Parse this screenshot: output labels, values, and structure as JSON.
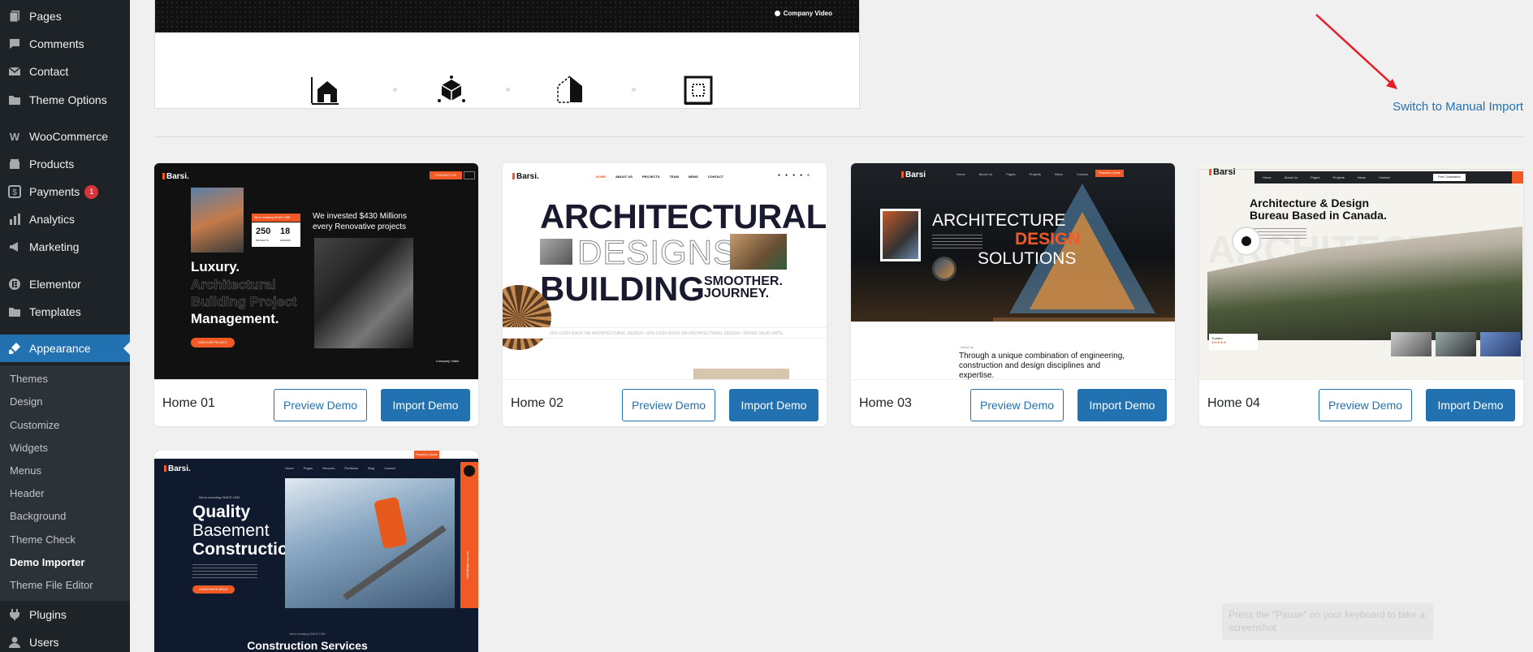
{
  "sidebar": {
    "items": [
      {
        "label": "Pages",
        "icon": "pages-icon"
      },
      {
        "label": "Comments",
        "icon": "comments-icon"
      },
      {
        "label": "Contact",
        "icon": "contact-icon"
      },
      {
        "label": "Theme Options",
        "icon": "folder-icon"
      },
      {
        "label": "WooCommerce",
        "icon": "woocommerce-icon"
      },
      {
        "label": "Products",
        "icon": "products-icon"
      },
      {
        "label": "Payments",
        "icon": "payments-icon",
        "badge": "1"
      },
      {
        "label": "Analytics",
        "icon": "analytics-icon"
      },
      {
        "label": "Marketing",
        "icon": "megaphone-icon"
      },
      {
        "label": "Elementor",
        "icon": "elementor-icon"
      },
      {
        "label": "Templates",
        "icon": "folder-icon"
      },
      {
        "label": "Appearance",
        "icon": "paintbrush-icon",
        "active": true
      },
      {
        "label": "Plugins",
        "icon": "plugins-icon"
      },
      {
        "label": "Users",
        "icon": "users-icon"
      }
    ],
    "submenu": [
      "Themes",
      "Design",
      "Customize",
      "Widgets",
      "Menus",
      "Header",
      "Background",
      "Theme Check",
      "Demo Importer",
      "Theme File Editor"
    ],
    "current_submenu": "Demo Importer"
  },
  "hero": {
    "video_label": "Company Video"
  },
  "manual_import_link": "Switch to Manual Import",
  "demos": [
    {
      "title": "Home 01",
      "preview_label": "Preview Demo",
      "import_label": "Import Demo"
    },
    {
      "title": "Home 02",
      "preview_label": "Preview Demo",
      "import_label": "Import Demo"
    },
    {
      "title": "Home 03",
      "preview_label": "Preview Demo",
      "import_label": "Import Demo"
    },
    {
      "title": "Home 04",
      "preview_label": "Preview Demo",
      "import_label": "Import Demo"
    }
  ],
  "thumbs": {
    "t1": {
      "logo": "Barsi.",
      "since": "We're Investing SINCE 1990",
      "stat1_num": "250",
      "stat1_lbl": "PROJECTS",
      "stat2_num": "18",
      "stat2_lbl": "AWARDS",
      "invest_text": "We invested $430 Millions every Renovative projects",
      "headline1": "Luxury.",
      "headline2": "Architectural",
      "headline3": "Building Project",
      "headline4": "Management.",
      "cta": "DISCOVER PROJECT",
      "video": "Company Video",
      "top_btn": "CONTACT US"
    },
    "t2": {
      "logo": "Barsi.",
      "nav": [
        "HOME",
        "ABOUT US",
        "PROJECTS",
        "TEAM",
        "NEWS",
        "CONTACT"
      ],
      "h1": "ARCHITECTURAL",
      "h2": "DESIGNS",
      "h3": "BUILDING",
      "h4a": "SMOOTHER.",
      "h4b": "JOURNEY.",
      "ticker": "20% CASH BACK ON ARCHITECTURAL DESIGN • 20% CASH BACK ON ARCHITECTURAL DESIGN • OFFER VALID UNTIL"
    },
    "t3": {
      "logo": "Barsi",
      "nav": [
        "Home",
        "About Us",
        "Pages",
        "Projects",
        "News",
        "Contact"
      ],
      "cta": "Request a Quote",
      "h1": "ARCHITECTURE",
      "h2": "DESIGN",
      "h3": "SOLUTIONS",
      "sub": "About us",
      "body": "Through a unique combination of engineering, construction and design disciplines and expertise."
    },
    "t4": {
      "logo": "Barsi",
      "nav": [
        "Home",
        "About Us",
        "Pages",
        "Projects",
        "News",
        "Contact"
      ],
      "cta": "Free Consultation",
      "h1": "Architecture & Design",
      "h2": "Bureau Based in Canada.",
      "bg_text": "ARCHITECTURE",
      "rating_label": "Trusted"
    },
    "t5": {
      "logo": "Barsi.",
      "top_cta": "Request a Quote",
      "nav": [
        "Home",
        "Pages",
        "Services",
        "Portfolios",
        "Blog",
        "Contact"
      ],
      "since": "We're investing SINCE 1990",
      "h1": "Quality",
      "h2": "Basement",
      "h3": "Construction",
      "cta": "LEARN MORE ABOUT",
      "email": "hello@agency.com",
      "bottom_since": "We're investing SINCE 1990",
      "bottom_title": "Construction Services"
    }
  },
  "pause_tip": "Press the \"Pause\" on your keyboard to take a screenshot",
  "colors": {
    "accent": "#2271b1",
    "brand_orange": "#f15a24",
    "sidebar": "#1d2327",
    "annotation_arrow": "#e31e24"
  }
}
